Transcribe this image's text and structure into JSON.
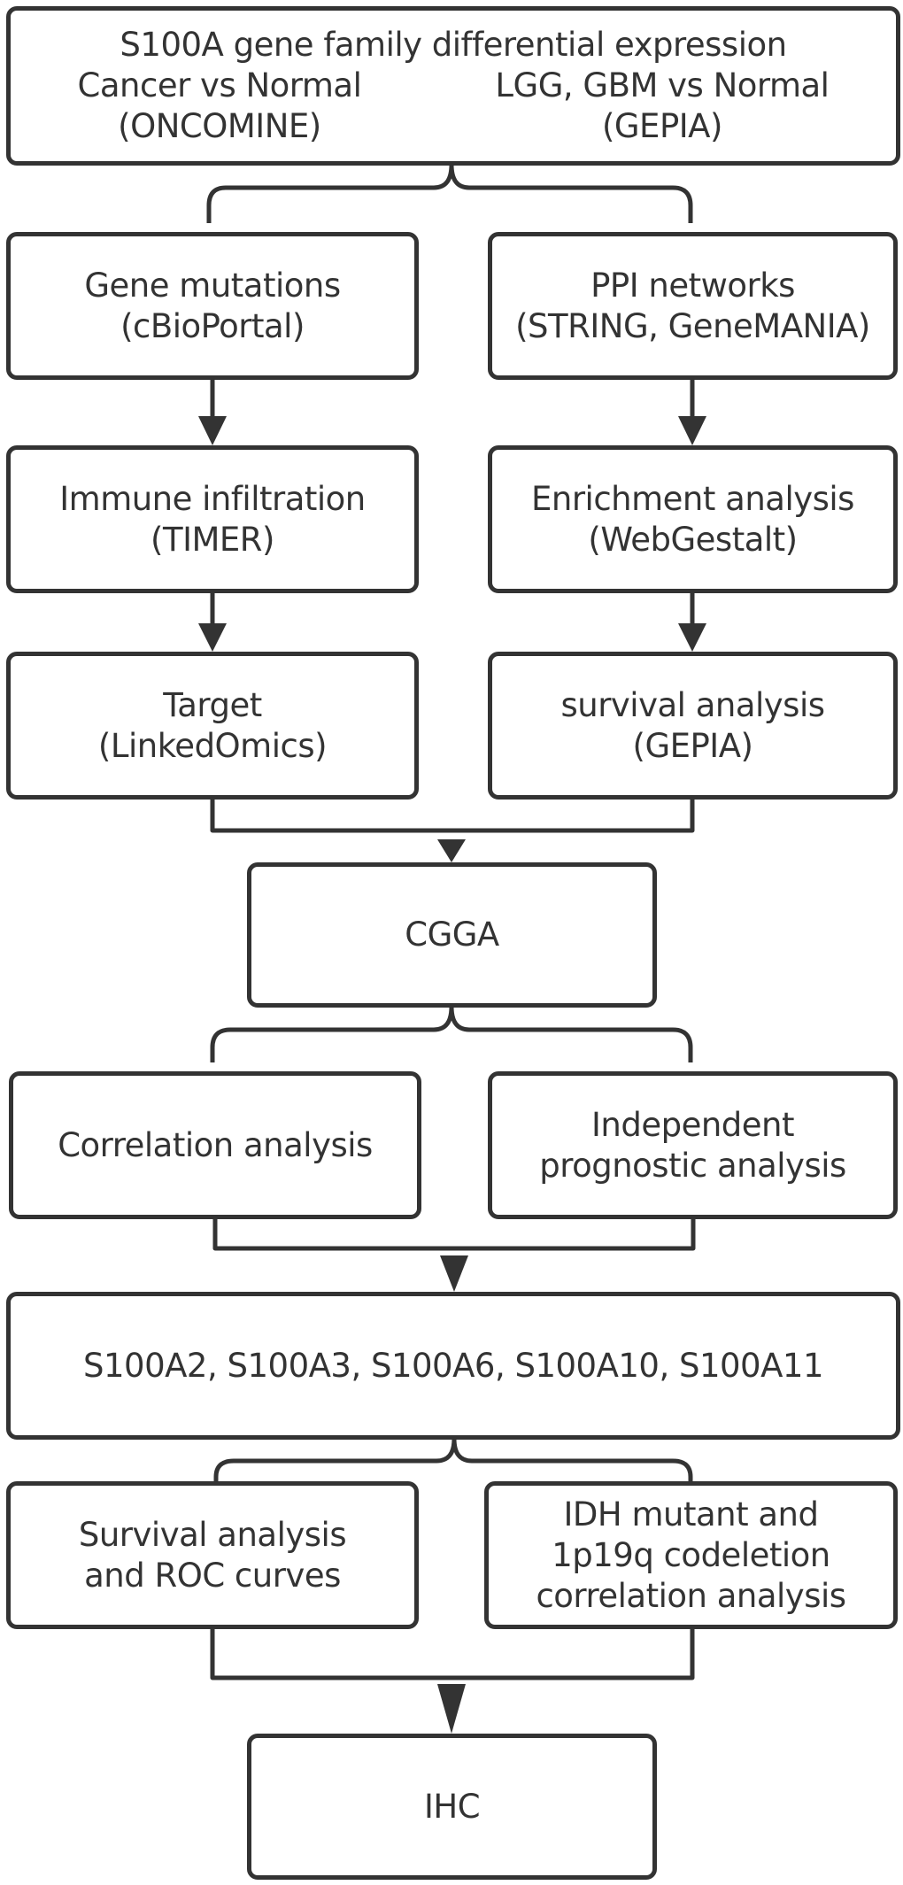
{
  "diagram": {
    "type": "flowchart",
    "nodes": {
      "top": {
        "title": "S100A gene family differential expression",
        "left_line1": "Cancer vs Normal",
        "left_line2": "(ONCOMINE)",
        "right_line1": "LGG, GBM vs Normal",
        "right_line2": "(GEPIA)"
      },
      "gene_mutations": {
        "line1": "Gene mutations",
        "line2": "(cBioPortal)"
      },
      "ppi": {
        "line1": "PPI networks",
        "line2": "(STRING, GeneMANIA)"
      },
      "immune": {
        "line1": "Immune infiltration",
        "line2": "(TIMER)"
      },
      "enrichment": {
        "line1": "Enrichment analysis",
        "line2": "(WebGestalt)"
      },
      "target": {
        "line1": "Target",
        "line2": "(LinkedOmics)"
      },
      "survival_gepia": {
        "line1": "survival analysis",
        "line2": "(GEPIA)"
      },
      "cgga": {
        "line1": "CGGA"
      },
      "correlation": {
        "line1": "Correlation analysis"
      },
      "independent": {
        "line1": "Independent",
        "line2": "prognostic analysis"
      },
      "genes": {
        "line1": "S100A2, S100A3, S100A6, S100A10, S100A11"
      },
      "survival_roc": {
        "line1": "Survival analysis",
        "line2": "and ROC curves"
      },
      "idh": {
        "line1": "IDH mutant and",
        "line2": "1p19q codeletion",
        "line3": "correlation analysis"
      },
      "ihc": {
        "line1": "IHC"
      }
    },
    "edges": [
      [
        "top",
        "gene_mutations"
      ],
      [
        "top",
        "ppi"
      ],
      [
        "gene_mutations",
        "immune"
      ],
      [
        "immune",
        "target"
      ],
      [
        "ppi",
        "enrichment"
      ],
      [
        "enrichment",
        "survival_gepia"
      ],
      [
        "target",
        "cgga"
      ],
      [
        "survival_gepia",
        "cgga"
      ],
      [
        "cgga",
        "correlation"
      ],
      [
        "cgga",
        "independent"
      ],
      [
        "correlation",
        "genes"
      ],
      [
        "independent",
        "genes"
      ],
      [
        "genes",
        "survival_roc"
      ],
      [
        "genes",
        "idh"
      ],
      [
        "survival_roc",
        "ihc"
      ],
      [
        "idh",
        "ihc"
      ]
    ],
    "colors": {
      "stroke": "#333333",
      "text": "#333333",
      "background": "#ffffff"
    }
  }
}
